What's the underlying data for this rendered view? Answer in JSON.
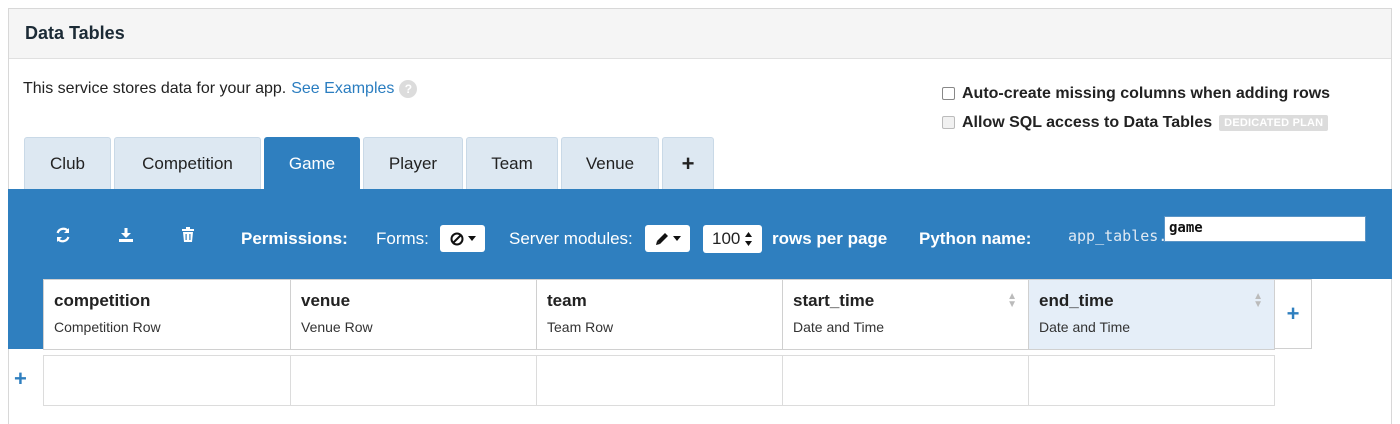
{
  "panel": {
    "title": "Data Tables"
  },
  "intro": {
    "text": "This service stores data for your app.",
    "link": "See Examples",
    "help_icon": "question-icon"
  },
  "options": {
    "auto_create": {
      "label": "Auto-create missing columns when adding rows",
      "checked": false
    },
    "sql_access": {
      "label": "Allow SQL access to Data Tables",
      "checked": false,
      "disabled": true,
      "badge": "DEDICATED PLAN"
    }
  },
  "tabs": [
    {
      "label": "Club",
      "active": false
    },
    {
      "label": "Competition",
      "active": false
    },
    {
      "label": "Game",
      "active": true
    },
    {
      "label": "Player",
      "active": false
    },
    {
      "label": "Team",
      "active": false
    },
    {
      "label": "Venue",
      "active": false
    },
    {
      "label": "+",
      "active": false
    }
  ],
  "toolbar": {
    "icons": [
      "refresh-icon",
      "download-icon",
      "trash-icon"
    ],
    "permissions_label": "Permissions:",
    "forms_label": "Forms:",
    "forms_value_icon": "no-access-icon",
    "server_modules_label": "Server modules:",
    "server_modules_value_icon": "pencil-icon",
    "rows_per_page_value": "100",
    "rows_per_page_label": "rows per page",
    "python_name_label": "Python name:",
    "python_prefix": "app_tables.",
    "python_name_value": "game"
  },
  "columns": [
    {
      "name": "competition",
      "type": "Competition Row",
      "sortable": false,
      "selected": false
    },
    {
      "name": "venue",
      "type": "Venue Row",
      "sortable": false,
      "selected": false
    },
    {
      "name": "team",
      "type": "Team Row",
      "sortable": false,
      "selected": false
    },
    {
      "name": "start_time",
      "type": "Date and Time",
      "sortable": true,
      "selected": false
    },
    {
      "name": "end_time",
      "type": "Date and Time",
      "sortable": true,
      "selected": true
    }
  ],
  "add_column_label": "+",
  "add_row_label": "+",
  "colors": {
    "accent": "#2f7fbf",
    "tab_bg": "#dde8f2",
    "selected_col": "#e5eef8",
    "link": "#2a7dc0"
  }
}
